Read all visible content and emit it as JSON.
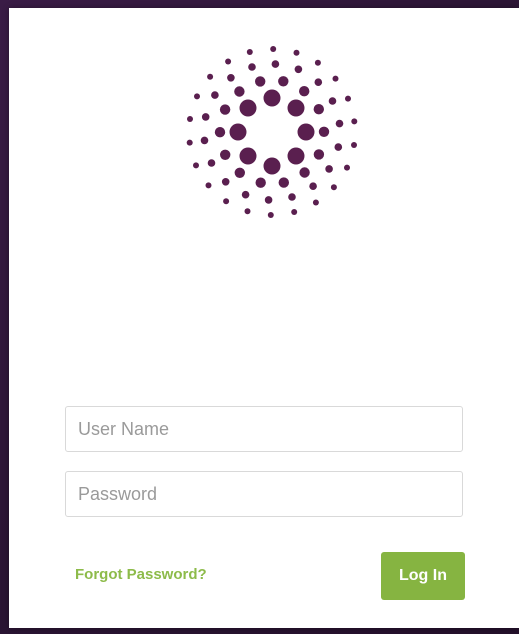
{
  "logo": {
    "icon": "dot-sunburst-logo",
    "color": "#5a1f4f"
  },
  "login_form": {
    "username_placeholder": "User Name",
    "username_value": "",
    "password_placeholder": "Password",
    "password_value": "",
    "forgot_password_label": "Forgot Password?",
    "login_button_label": "Log In"
  },
  "colors": {
    "accent_green": "#86b441",
    "link_green": "#8dbb4a",
    "brand_purple": "#5a1f4f",
    "background": "#2b1534"
  }
}
